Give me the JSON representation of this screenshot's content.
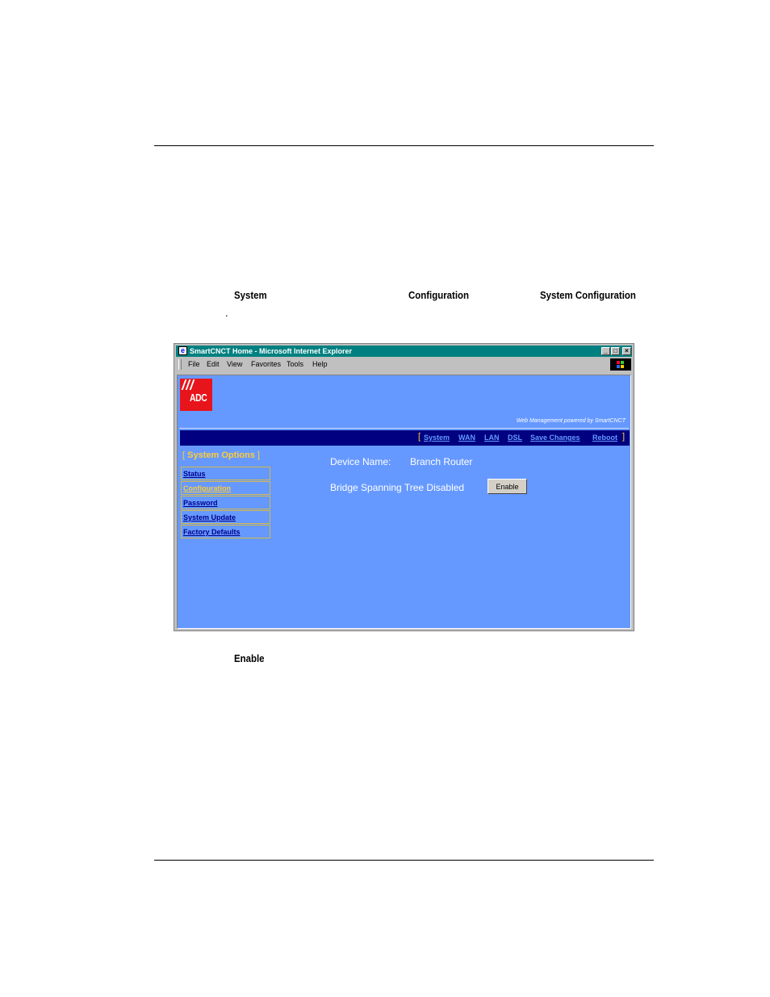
{
  "doc": {
    "label_system": "System",
    "label_configuration": "Configuration",
    "label_system_configuration": "System Configuration",
    "period": ".",
    "label_enable": "Enable"
  },
  "window": {
    "title": "SmartCNCT Home - Microsoft Internet Explorer",
    "menu": [
      "File",
      "Edit",
      "View",
      "Favorites",
      "Tools",
      "Help"
    ]
  },
  "page": {
    "logo_text": "ADC",
    "powered_by": "Web Management powered by SmartCNCT",
    "nav": [
      "System",
      "WAN",
      "LAN",
      "DSL",
      "Save Changes",
      "Reboot"
    ],
    "sidebar": {
      "heading": "System Options",
      "items": [
        "Status",
        "Configuration",
        "Password",
        "System Update",
        "Factory Defaults"
      ]
    },
    "device_name_label": "Device Name:",
    "device_name_value": "Branch Router",
    "bridge_status": "Bridge Spanning Tree Disabled",
    "enable_button": "Enable"
  },
  "colors": {
    "page_bg": "#6699ff",
    "navbar_bg": "#000080",
    "accent": "#ffcc33",
    "logo_red": "#e8141b",
    "titlebar": "#008080"
  }
}
